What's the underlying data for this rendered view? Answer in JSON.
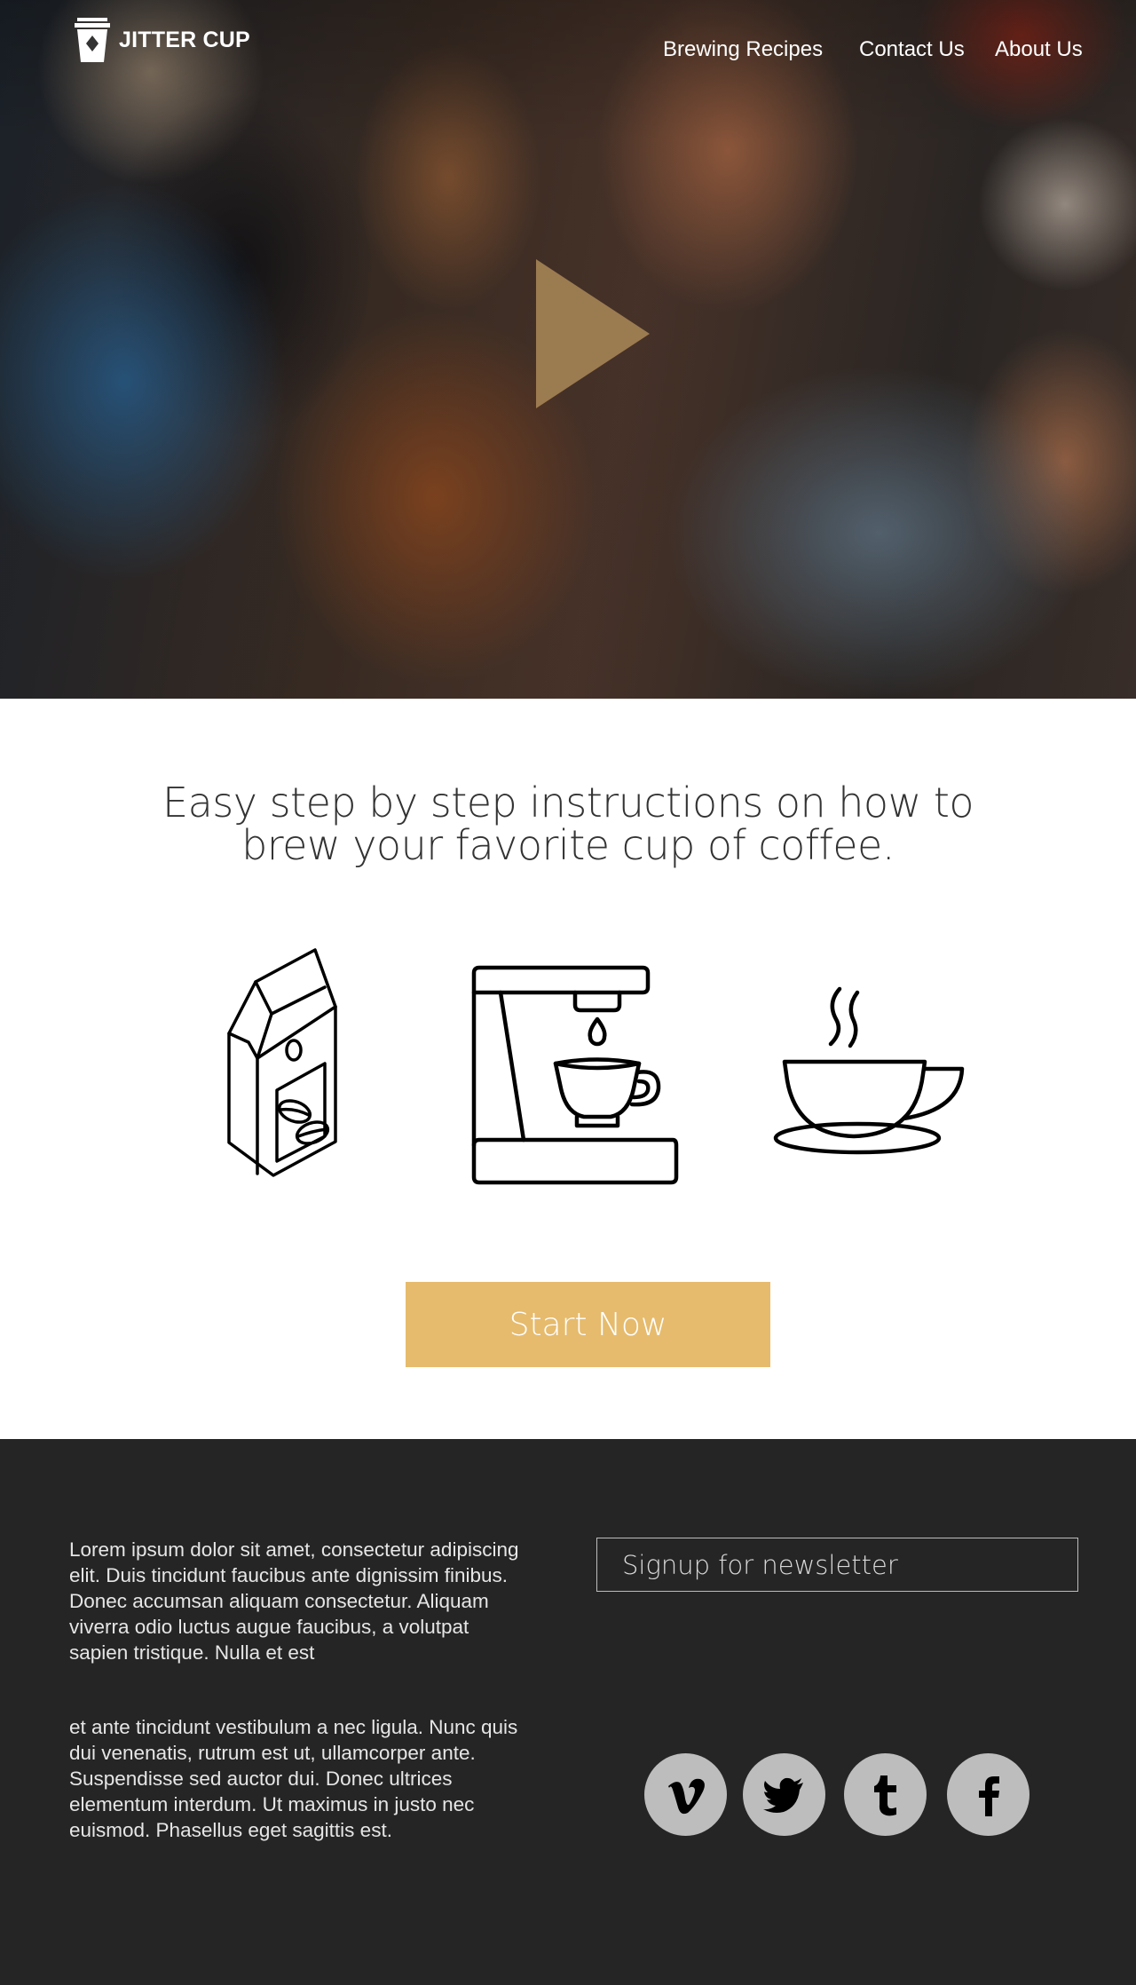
{
  "header": {
    "brand_name": "JITTER CUP",
    "brand_icon": "coffee-cup-logo",
    "nav": [
      {
        "label": "Brewing Recipes"
      },
      {
        "label": "Contact Us"
      },
      {
        "label": "About Us"
      }
    ]
  },
  "hero": {
    "play_icon": "play-icon",
    "play_color": "#a0805a"
  },
  "main": {
    "tagline": "Easy step by step instructions on how to brew your favorite cup of coffee.",
    "steps": [
      {
        "icon": "coffee-bag-icon"
      },
      {
        "icon": "coffee-maker-icon"
      },
      {
        "icon": "coffee-cup-icon"
      }
    ],
    "start_button": "Start Now",
    "accent_color": "#e6bb6d"
  },
  "footer": {
    "paragraph1": "Lorem ipsum dolor sit amet, consectetur adipiscing elit. Duis tincidunt faucibus ante dignissim finibus. Donec accumsan aliquam consectetur. Aliquam viverra odio luctus augue faucibus, a volutpat sapien tristique. Nulla et est",
    "paragraph2": "et ante tincidunt vestibulum a nec ligula. Nunc quis dui venenatis, rutrum est ut, ullamcorper ante. Suspendisse sed auctor dui. Donec ultrices elementum interdum. Ut maximus in justo nec euismod. Phasellus eget sagittis est.",
    "newsletter_placeholder": "Signup for newsletter",
    "social": [
      {
        "icon": "vimeo-icon"
      },
      {
        "icon": "twitter-icon"
      },
      {
        "icon": "tumblr-icon"
      },
      {
        "icon": "facebook-icon"
      }
    ],
    "background_color": "#252525"
  }
}
